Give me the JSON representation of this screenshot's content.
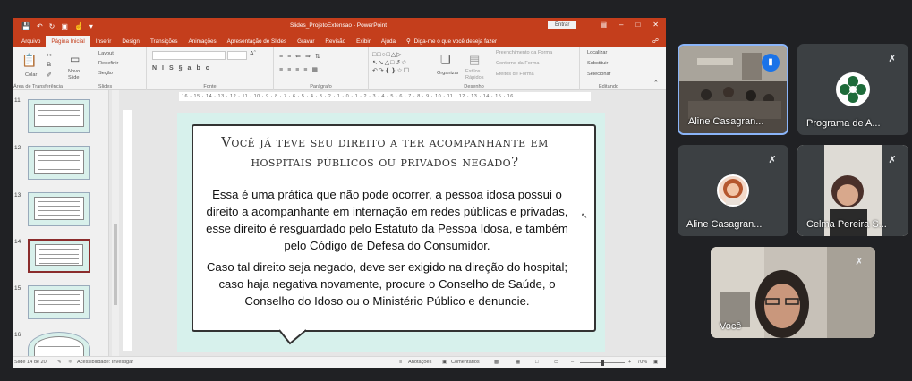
{
  "ppt": {
    "doc_title": "Slides_ProjetoExtensao - PowerPoint",
    "login_label": "Entrar",
    "menu_tabs": [
      "Arquivo",
      "Página Inicial",
      "Inserir",
      "Design",
      "Transições",
      "Animações",
      "Apresentação de Slides",
      "Gravar",
      "Revisão",
      "Exibir",
      "Ajuda"
    ],
    "tell_me": "Diga-me o que você deseja fazer",
    "ribbon": {
      "paste": "Colar",
      "layout": "Layout",
      "reset": "Redefinir",
      "new_slide": "Novo Slide",
      "section": "Seção",
      "organize": "Organizar",
      "quick_styles": "Estilos Rápidos",
      "shape_fill": "Preenchimento da Forma",
      "shape_outline": "Contorno da Forma",
      "shape_effects": "Efeitos de Forma",
      "find": "Localizar",
      "replace": "Substituir",
      "select": "Selecionar",
      "groups": [
        "Área de Transferência",
        "Slides",
        "Fonte",
        "Parágrafo",
        "Desenho",
        "Editando"
      ]
    },
    "thumbnails": [
      {
        "num": "11",
        "selected": false
      },
      {
        "num": "12",
        "selected": false
      },
      {
        "num": "13",
        "selected": false
      },
      {
        "num": "14",
        "selected": true
      },
      {
        "num": "15",
        "selected": false
      },
      {
        "num": "16",
        "selected": false
      }
    ],
    "ruler_h": "16 · 15 · 14 · 13 · 12 · 11 · 10 · 9 · 8 · 7 · 6 · 5 · 4 · 3 · 2 · 1 · 0 · 1 · 2 · 3 · 4 · 5 · 6 · 7 · 8 · 9 · 10 · 11 · 12 · 13 · 14 · 15 · 16",
    "slide": {
      "title": "Você já teve seu direito a ter acompanhante em hospitais públicos ou privados negado?",
      "paragraph1": "Essa é uma prática que não pode ocorrer, a pessoa idosa possui o direito a acompanhante em internação em redes públicas e privadas, esse direito é resguardado pelo Estatuto da Pessoa Idosa, e também pelo Código de Defesa do Consumidor.",
      "paragraph2": "Caso tal direito seja negado, deve ser exigido na direção do hospital; caso haja negativa novamente, procure o Conselho de Saúde, o Conselho do Idoso ou o Ministério Público e denuncie."
    },
    "status": {
      "slide_count": "Slide 14 de 20",
      "accessibility": "Acessibilidade: Investigar",
      "notes": "Anotações",
      "comments": "Comentários",
      "zoom": "70%"
    }
  },
  "meet": {
    "tiles": [
      {
        "name": "Aline Casagran...",
        "muted": false,
        "speaking": true
      },
      {
        "name": "Programa de A...",
        "muted": true
      },
      {
        "name": "Aline Casagran...",
        "muted": true
      },
      {
        "name": "Celma Pereira S...",
        "muted": true
      },
      {
        "name": "Você",
        "muted": true
      }
    ]
  },
  "colors": {
    "ppt_accent": "#c43e1c",
    "slide_bg": "#d7f1ec",
    "meet_bg": "#202124",
    "tile_bg": "#3c4043",
    "active_border": "#8ab4f8"
  }
}
